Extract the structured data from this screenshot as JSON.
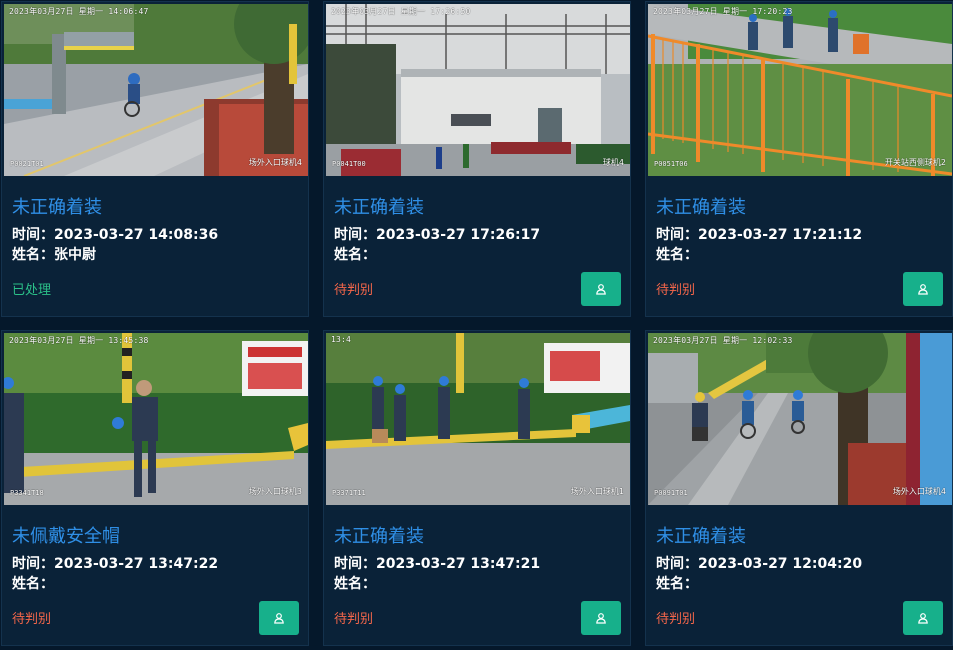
{
  "colors": {
    "background": "#05182b",
    "card": "#0a2238",
    "title": "#2f8fe6",
    "status_done": "#2bbf88",
    "status_pending": "#f4664a",
    "button": "#17b08b"
  },
  "labels": {
    "time_prefix": "时间：",
    "name_prefix": "姓名："
  },
  "cards": [
    {
      "violation": "未正确着装",
      "time_label": "时间：2023-03-27 14:08:36",
      "name_label": "姓名：张中尉",
      "status": "已处理",
      "show_button": false,
      "osd_time": "2023年03月27日  星期一  14:06:47",
      "osd_id": "P0021T01",
      "osd_camera": "场外入口球机4",
      "scene": "gate",
      "button_icon": "user-icon"
    },
    {
      "violation": "未正确着装",
      "time_label": "时间：2023-03-27 17:26:17",
      "name_label": "姓名：",
      "status": "待判别",
      "show_button": true,
      "osd_time": "2023年03月27日  星期一  17:26:50",
      "osd_id": "P0041T00",
      "osd_camera": "球机4",
      "scene": "substation",
      "button_icon": "user-icon"
    },
    {
      "violation": "未正确着装",
      "time_label": "时间：2023-03-27 17:21:12",
      "name_label": "姓名：",
      "status": "待判别",
      "show_button": true,
      "osd_time": "2023年03月27日  星期一  17:20:23",
      "osd_id": "P0051T06",
      "osd_camera": "开关站西侧球机2",
      "scene": "fence",
      "button_icon": "user-icon"
    },
    {
      "violation": "未佩戴安全帽",
      "time_label": "时间：2023-03-27 13:47:22",
      "name_label": "姓名：",
      "status": "待判别",
      "show_button": true,
      "osd_time": "2023年03月27日  星期一  13:45:38",
      "osd_id": "P3341T18",
      "osd_camera": "场外入口球机3",
      "scene": "walkway-one",
      "button_icon": "user-icon"
    },
    {
      "violation": "未正确着装",
      "time_label": "时间：2023-03-27 13:47:21",
      "name_label": "姓名：",
      "status": "待判别",
      "show_button": true,
      "osd_time": "13:4",
      "osd_id": "P3371T11",
      "osd_camera": "场外入口球机1",
      "scene": "walkway-group",
      "button_icon": "user-icon"
    },
    {
      "violation": "未正确着装",
      "time_label": "时间：2023-03-27 12:04:20",
      "name_label": "姓名：",
      "status": "待判别",
      "show_button": true,
      "osd_time": "2023年03月27日  星期一  12:02:33",
      "osd_id": "P0091T01",
      "osd_camera": "场外入口球机4",
      "scene": "cyclists",
      "button_icon": "user-icon"
    }
  ]
}
